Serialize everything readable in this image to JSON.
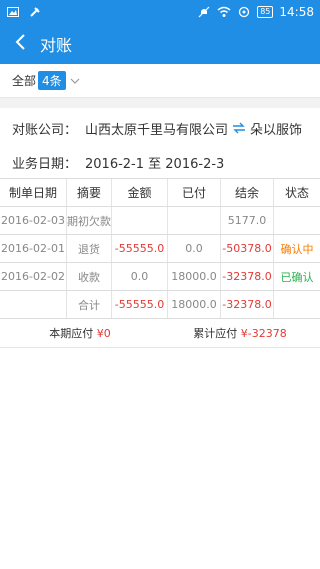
{
  "statusbar": {
    "battery": "85",
    "time": "14:58"
  },
  "header": {
    "title": "对账"
  },
  "filter": {
    "label": "全部",
    "count": "4条"
  },
  "info": {
    "company_label": "对账公司：",
    "company_from": "山西太原千里马有限公司",
    "company_to": "朵以服饰",
    "date_label": "业务日期：",
    "date_range": "2016-2-1 至 2016-2-3"
  },
  "table": {
    "headers": [
      "制单日期",
      "摘要",
      "金额",
      "已付",
      "结余",
      "状态"
    ],
    "rows": [
      {
        "date": "2016-02-03",
        "summary": "期初欠款",
        "amount": "",
        "paid": "",
        "balance": "5177.0",
        "status": ""
      },
      {
        "date": "2016-02-01",
        "summary": "退货",
        "amount": "-55555.0",
        "paid": "0.0",
        "balance": "-50378.0",
        "status": "确认中"
      },
      {
        "date": "2016-02-02",
        "summary": "收款",
        "amount": "0.0",
        "paid": "18000.0",
        "balance": "-32378.0",
        "status": "已确认"
      }
    ],
    "total": {
      "summary": "合计",
      "amount": "-55555.0",
      "paid": "18000.0",
      "balance": "-32378.0"
    }
  },
  "footer": {
    "period_label": "本期应付",
    "period_value": "¥0",
    "cumulative_label": "累计应付",
    "cumulative_value": "¥-32378"
  }
}
